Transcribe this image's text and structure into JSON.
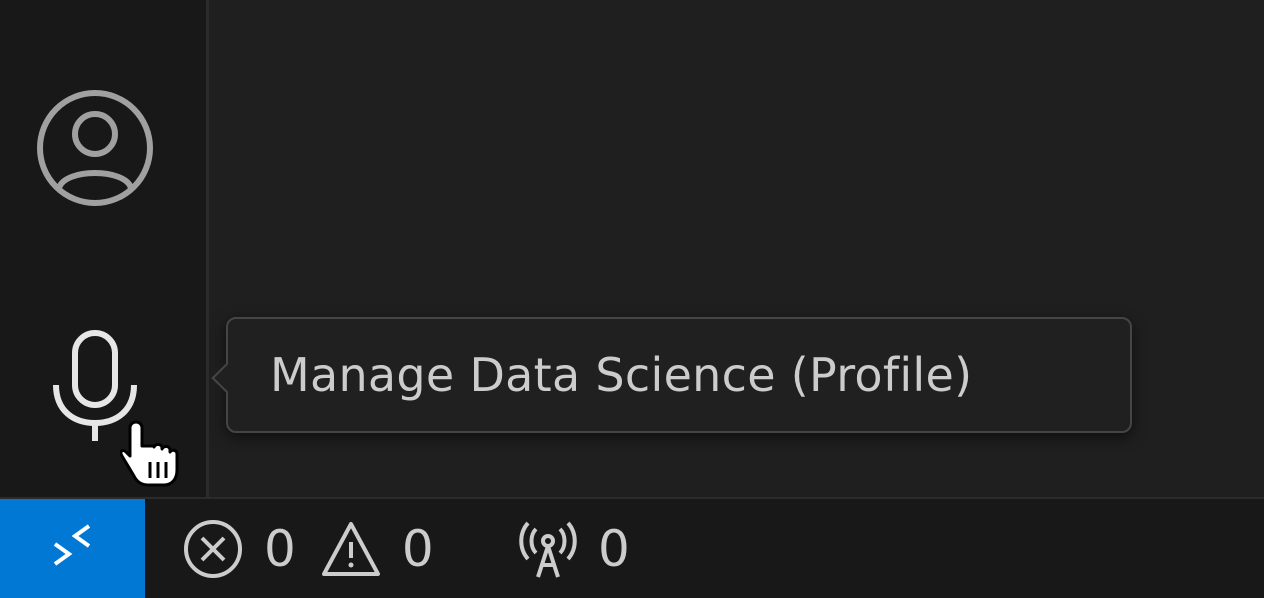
{
  "tooltip": {
    "text": "Manage Data Science (Profile)"
  },
  "activity_bar": {
    "items": [
      {
        "name": "accounts",
        "icon": "account-icon"
      },
      {
        "name": "voice",
        "icon": "microphone-icon"
      }
    ]
  },
  "status_bar": {
    "remote_icon": "remote-indicator-icon",
    "errors": "0",
    "warnings": "0",
    "ports": "0"
  },
  "colors": {
    "background": "#1f1f1f",
    "activity_bar": "#181818",
    "remote_accent": "#0078d4",
    "foreground": "#cccccc",
    "icon": "#a0a0a0"
  }
}
